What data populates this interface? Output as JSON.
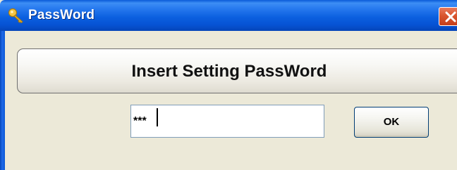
{
  "window": {
    "title": "PassWord",
    "title_icon": "key-icon",
    "close_icon": "close-icon",
    "colors": {
      "titlebar": "#0c60e0",
      "close_button": "#d9552f",
      "body": "#ece9d8"
    }
  },
  "banner": {
    "text": "Insert Setting PassWord"
  },
  "password_field": {
    "value": "***"
  },
  "ok_button": {
    "label": "OK"
  }
}
